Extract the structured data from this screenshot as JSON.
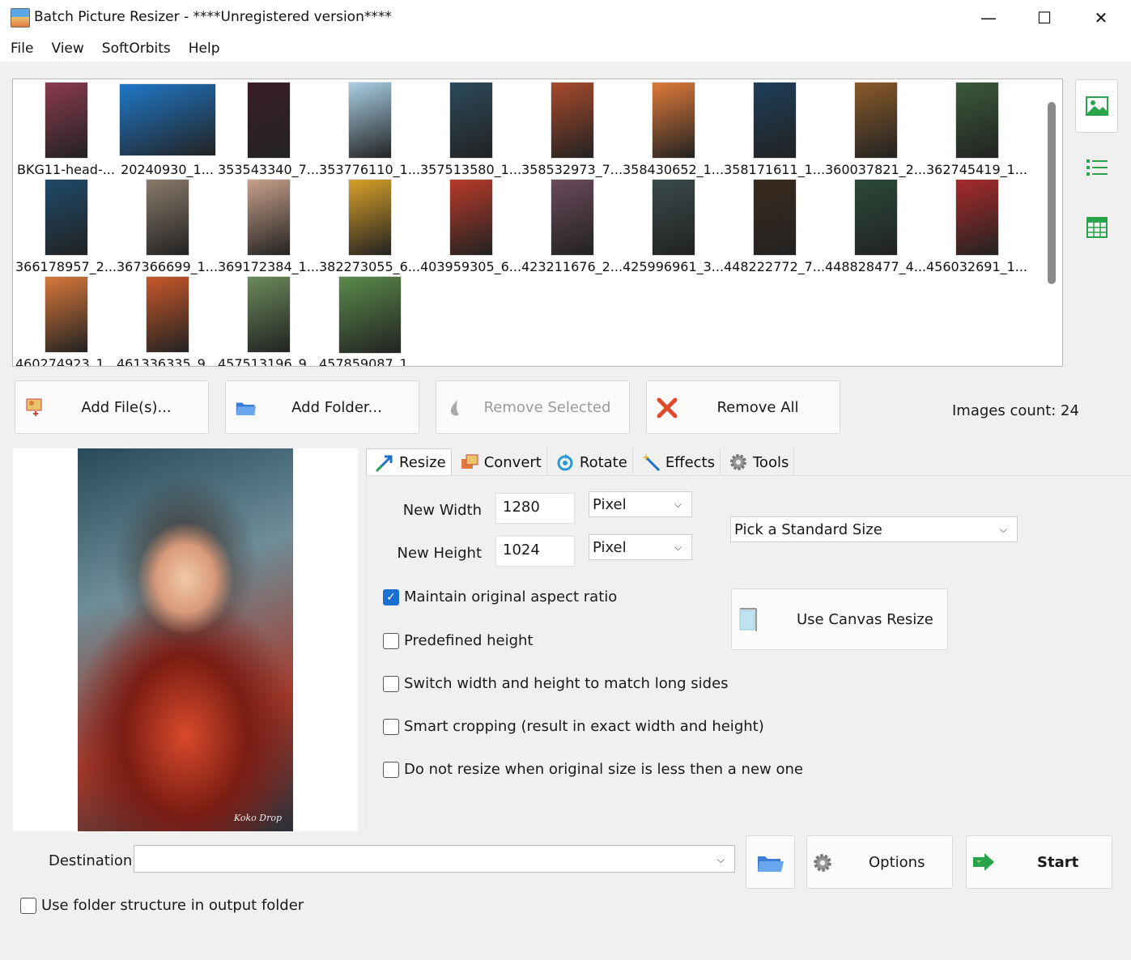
{
  "window": {
    "title": "Batch Picture Resizer - ****Unregistered version****",
    "minimize": "—",
    "maximize": "☐",
    "close": "✕"
  },
  "menu": {
    "file": "File",
    "view": "View",
    "softorbits": "SoftOrbits",
    "help": "Help"
  },
  "files": [
    {
      "name": "BKG11-head-...",
      "color": "#8a3a50"
    },
    {
      "name": "20240930_1...",
      "color": "#1f78c8"
    },
    {
      "name": "353543340_7...",
      "color": "#3a1e2a"
    },
    {
      "name": "353776110_1...",
      "color": "#a9d0e6"
    },
    {
      "name": "357513580_1...",
      "color": "#2c4a5a"
    },
    {
      "name": "358532973_7...",
      "color": "#a84a2c"
    },
    {
      "name": "358430652_1...",
      "color": "#e07a3a"
    },
    {
      "name": "358171611_1...",
      "color": "#1e3e5a"
    },
    {
      "name": "360037821_2...",
      "color": "#8a5a2a"
    },
    {
      "name": "362745419_1...",
      "color": "#3a5a3a"
    },
    {
      "name": "366178957_2...",
      "color": "#1e4a6a"
    },
    {
      "name": "367366699_1...",
      "color": "#8a7a6a"
    },
    {
      "name": "369172384_1...",
      "color": "#c8a08a"
    },
    {
      "name": "382273055_6...",
      "color": "#d8a028"
    },
    {
      "name": "403959305_6...",
      "color": "#b83a2a"
    },
    {
      "name": "423211676_2...",
      "color": "#6a4a5a"
    },
    {
      "name": "425996961_3...",
      "color": "#3a4a4a"
    },
    {
      "name": "448222772_7...",
      "color": "#3a2a1e"
    },
    {
      "name": "448828477_4...",
      "color": "#2a4a3a"
    },
    {
      "name": "456032691_1...",
      "color": "#a82a2a"
    },
    {
      "name": "460274923_1...",
      "color": "#d8783a"
    },
    {
      "name": "461336335_9...",
      "color": "#c8582a"
    },
    {
      "name": "457513196_9...",
      "color": "#6a8a5a"
    },
    {
      "name": "457859087_1...",
      "color": "#5a8a4a"
    }
  ],
  "buttons": {
    "add_files": "Add File(s)...",
    "add_folder": "Add Folder...",
    "remove_selected": "Remove Selected",
    "remove_all": "Remove All"
  },
  "images_count": "Images count: 24",
  "preview": {
    "signature": "Koko Drop"
  },
  "tabs": [
    {
      "label": "Resize",
      "icon": "resize-icon"
    },
    {
      "label": "Convert",
      "icon": "convert-icon"
    },
    {
      "label": "Rotate",
      "icon": "rotate-icon"
    },
    {
      "label": "Effects",
      "icon": "effects-icon"
    },
    {
      "label": "Tools",
      "icon": "gear-icon"
    }
  ],
  "resize": {
    "new_width_label": "New Width",
    "new_width": "1280",
    "width_unit": "Pixel",
    "new_height_label": "New Height",
    "new_height": "1024",
    "height_unit": "Pixel",
    "standard_size": "Pick a Standard Size",
    "canvas_resize": "Use Canvas Resize",
    "options": [
      {
        "label": "Maintain original aspect ratio",
        "checked": true
      },
      {
        "label": "Predefined height",
        "checked": false
      },
      {
        "label": "Switch width and height to match long sides",
        "checked": false
      },
      {
        "label": "Smart cropping (result in exact width and height)",
        "checked": false
      },
      {
        "label": "Do not resize when original size is less then a new one",
        "checked": false
      }
    ]
  },
  "destination": {
    "label": "Destination",
    "value": "",
    "options_button": "Options",
    "start_button": "Start",
    "use_folder_structure": "Use folder structure in output folder"
  }
}
